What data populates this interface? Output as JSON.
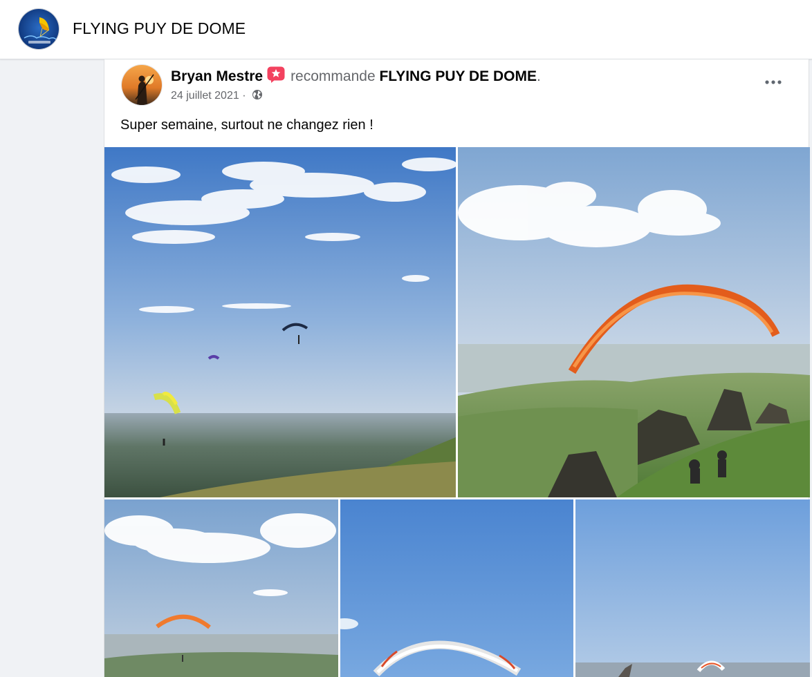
{
  "header": {
    "page_name": "FLYING PUY DE DOME",
    "logo_icon": "paraglider-logo-icon"
  },
  "post": {
    "author": "Bryan Mestre",
    "badge_icon": "recommend-star-icon",
    "recommend_text": "recommande",
    "page_name": "FLYING PUY DE DOME",
    "punctuation": ".",
    "date": "24 juillet 2021",
    "separator": "·",
    "audience_icon": "globe-icon",
    "more_icon": "more-options-icon",
    "text": "Super semaine, surtout ne changez rien !",
    "photos": [
      "paragliders-sky-photo",
      "orange-glider-mountain-photo",
      "orange-glider-valley-photo",
      "white-glider-blue-sky-photo",
      "glider-takeoff-photo"
    ]
  },
  "colors": {
    "page_bg": "#f0f2f5",
    "card_bg": "#ffffff",
    "secondary_text": "#65676b",
    "badge_pink": "#f3425f",
    "glider_orange": "#f07a2e"
  }
}
